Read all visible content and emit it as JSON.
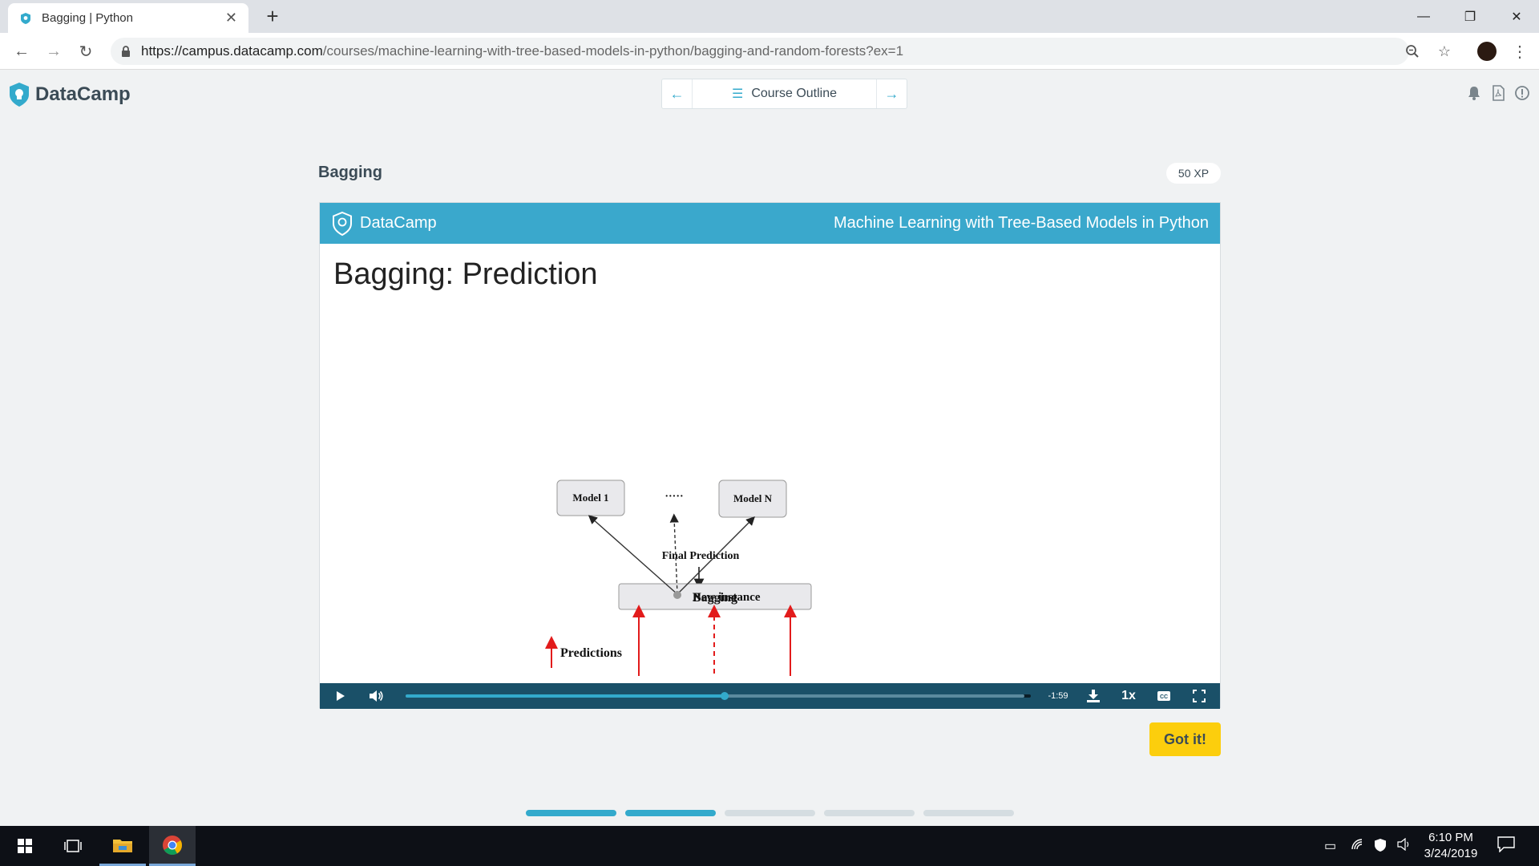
{
  "browser": {
    "tab_title": "Bagging | Python",
    "url_host": "https://campus.datacamp.com",
    "url_path": "/courses/machine-learning-with-tree-based-models-in-python/bagging-and-random-forests?ex=1"
  },
  "header": {
    "brand": "DataCamp",
    "course_outline": "Course Outline",
    "icons": [
      "bell-icon",
      "pdf-icon",
      "info-icon"
    ]
  },
  "exercise": {
    "title": "Bagging",
    "xp": "50 XP",
    "got_it": "Got it!"
  },
  "slide": {
    "brand": "DataCamp",
    "course": "Machine Learning with Tree-Based Models in Python",
    "title": "Bagging: Prediction",
    "diagram": {
      "final_prediction": "Final Prediction",
      "bagging": "Bagging",
      "predictions": "Predictions",
      "model_1": "Model 1",
      "ellipsis": "·····",
      "model_n": "Model N",
      "new_instance": "New instance"
    }
  },
  "player": {
    "time_remaining": "-1:59",
    "speed": "1x",
    "progress": 0.51
  },
  "progress_steps": [
    {
      "state": "done"
    },
    {
      "state": "done"
    },
    {
      "state": "todo"
    },
    {
      "state": "todo"
    },
    {
      "state": "todo"
    }
  ],
  "taskbar": {
    "time": "6:10 PM",
    "date": "3/24/2019"
  },
  "colors": {
    "accent": "#33aacc",
    "player_bg": "#1a5068",
    "button_yellow": "#fcce0d",
    "step_done": "#33aacc",
    "step_todo": "#d5dde1"
  }
}
